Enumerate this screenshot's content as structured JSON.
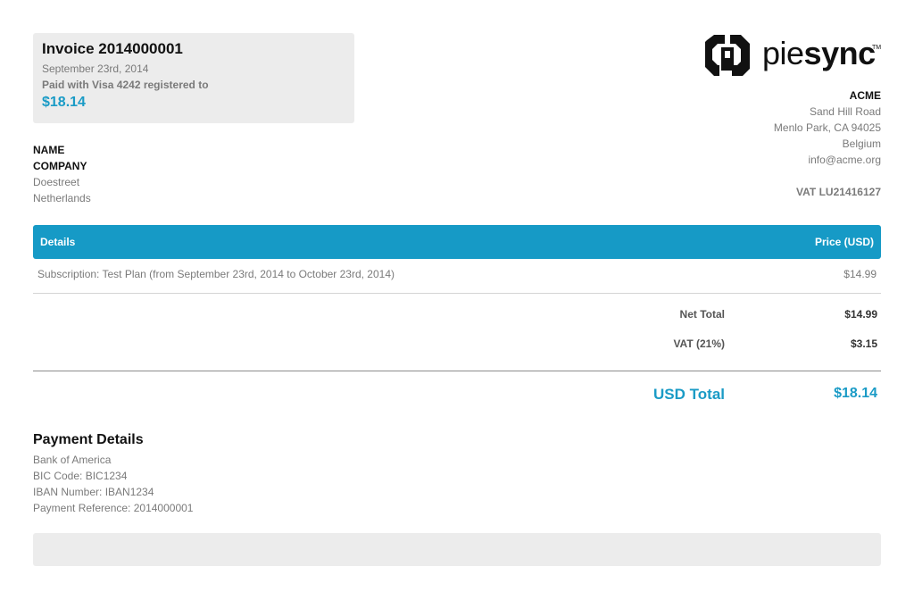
{
  "invoice": {
    "title": "Invoice 2014000001",
    "date": "September 23rd, 2014",
    "paid_with": "Paid with Visa 4242 registered to",
    "amount": "$18.14"
  },
  "logo": {
    "text_light": "pie",
    "text_bold": "sync",
    "trademark": "TM"
  },
  "seller": {
    "name": "ACME",
    "street": "Sand Hill Road",
    "city": "Menlo Park, CA 94025",
    "country": "Belgium",
    "email": "info@acme.org",
    "vat": "VAT LU21416127"
  },
  "buyer": {
    "name": "NAME",
    "company": "COMPANY",
    "street": "Doestreet",
    "country": "Netherlands"
  },
  "table": {
    "header_details": "Details",
    "header_price": "Price (USD)",
    "items": [
      {
        "description": "Subscription: Test Plan (from September 23rd, 2014 to October 23rd, 2014)",
        "price": "$14.99"
      }
    ]
  },
  "totals": {
    "net_label": "Net Total",
    "net_value": "$14.99",
    "vat_label": "VAT (21%)",
    "vat_value": "$3.15",
    "usd_label": "USD Total",
    "usd_value": "$18.14"
  },
  "payment": {
    "title": "Payment Details",
    "bank": "Bank of America",
    "bic": "BIC Code: BIC1234",
    "iban": "IBAN Number: IBAN1234",
    "reference": "Payment Reference: 2014000001"
  },
  "colors": {
    "accent": "#169ac6",
    "card_bg": "#ececec"
  }
}
